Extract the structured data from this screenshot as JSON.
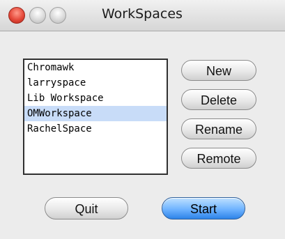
{
  "window": {
    "title": "WorkSpaces"
  },
  "workspaces": {
    "items": [
      "Chromawk",
      "larryspace",
      "Lib Workspace",
      "OMWorkspace",
      "RachelSpace"
    ],
    "selected_index": 3
  },
  "actions": {
    "new_label": "New",
    "delete_label": "Delete",
    "rename_label": "Rename",
    "remote_label": "Remote"
  },
  "footer": {
    "quit_label": "Quit",
    "start_label": "Start"
  },
  "colors": {
    "selection": "#c8dcf8",
    "default_button": "#6fb3ff"
  }
}
